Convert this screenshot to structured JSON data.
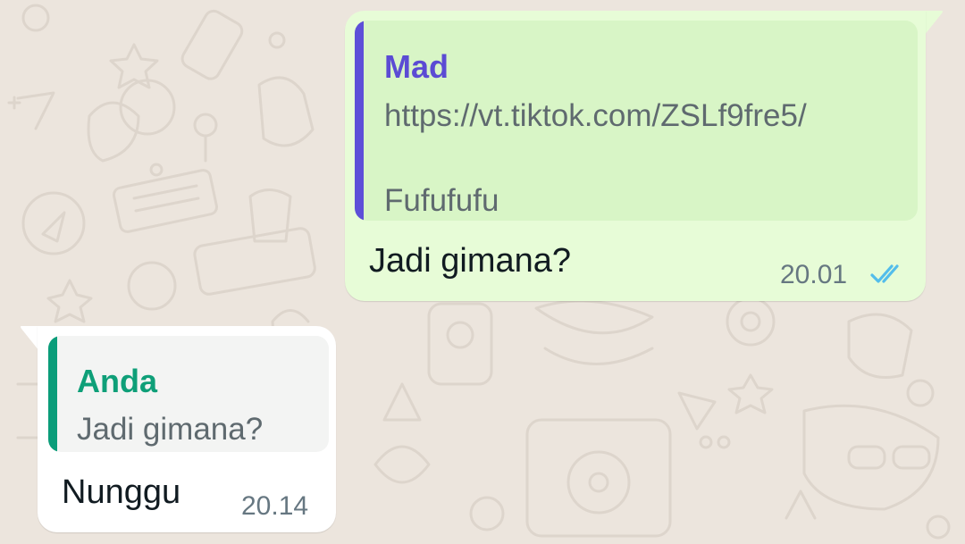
{
  "chat": {
    "messages": [
      {
        "direction": "outgoing",
        "quote": {
          "author": "Mad",
          "line1": "https://vt.tiktok.com/ZSLf9fre5/",
          "line2": "Fufufufu"
        },
        "text": "Jadi gimana?",
        "time": "20.01",
        "status_icon": "double-check-read-icon"
      },
      {
        "direction": "incoming",
        "quote": {
          "author": "Anda",
          "line1": "Jadi gimana?"
        },
        "text": "Nunggu",
        "time": "20.14"
      }
    ]
  },
  "colors": {
    "wallpaper": "#ece5dd",
    "outgoing_bubble": "#e7fcd7",
    "incoming_bubble": "#ffffff",
    "quote_author_outgoing": "#5b4bd4",
    "quote_author_incoming": "#0e9f78",
    "read_ticks": "#53bdeb"
  }
}
